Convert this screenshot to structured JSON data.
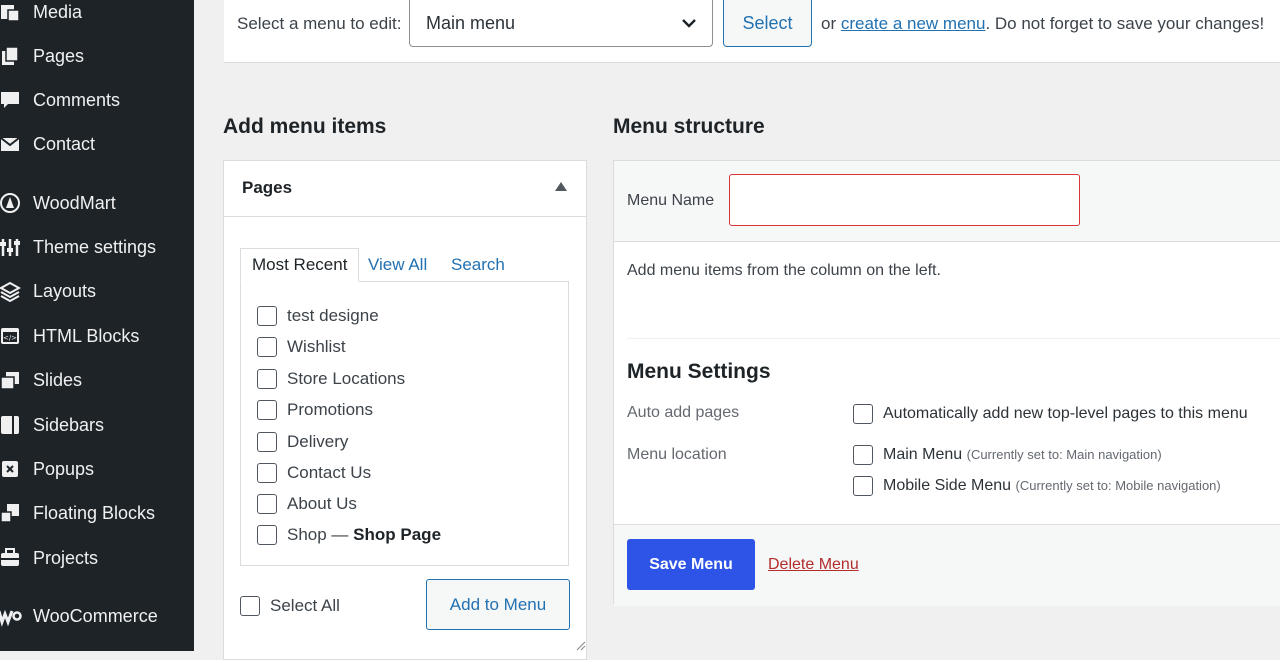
{
  "sidebar": {
    "items": [
      {
        "label": "Media",
        "icon": "media-icon"
      },
      {
        "label": "Pages",
        "icon": "pages-icon"
      },
      {
        "label": "Comments",
        "icon": "comments-icon"
      },
      {
        "label": "Contact",
        "icon": "mail-icon"
      },
      {
        "label": "WoodMart",
        "icon": "woodmart-icon"
      },
      {
        "label": "Theme settings",
        "icon": "sliders-icon"
      },
      {
        "label": "Layouts",
        "icon": "layers-icon"
      },
      {
        "label": "HTML Blocks",
        "icon": "html-icon"
      },
      {
        "label": "Slides",
        "icon": "slides-icon"
      },
      {
        "label": "Sidebars",
        "icon": "sidebar-icon"
      },
      {
        "label": "Popups",
        "icon": "popup-icon"
      },
      {
        "label": "Floating Blocks",
        "icon": "floating-icon"
      },
      {
        "label": "Projects",
        "icon": "briefcase-icon"
      },
      {
        "label": "WooCommerce",
        "icon": "woocommerce-icon"
      }
    ]
  },
  "topbar": {
    "label": "Select a menu to edit:",
    "selected_menu": "Main menu",
    "select_button": "Select",
    "hint_prefix": "or",
    "create_link": "create a new menu",
    "hint_suffix": ". Do not forget to save your changes!"
  },
  "add_items": {
    "heading": "Add menu items",
    "panel_title": "Pages",
    "tabs": [
      "Most Recent",
      "View All",
      "Search"
    ],
    "pages": [
      "test designe",
      "Wishlist",
      "Store Locations",
      "Promotions",
      "Delivery",
      "Contact Us",
      "About Us"
    ],
    "shop_label": "Shop —",
    "shop_suffix": "Shop Page",
    "select_all": "Select All",
    "add_button": "Add to Menu"
  },
  "structure": {
    "heading": "Menu structure",
    "name_label": "Menu Name",
    "name_value": "",
    "hint": "Add menu items from the column on the left.",
    "settings_title": "Menu Settings",
    "auto_add_label": "Auto add pages",
    "auto_add_option": "Automatically add new top-level pages to this menu",
    "location_label": "Menu location",
    "locations": [
      {
        "name": "Main Menu",
        "note": "(Currently set to: Main navigation)"
      },
      {
        "name": "Mobile Side Menu",
        "note": "(Currently set to: Mobile navigation)"
      }
    ],
    "save_button": "Save Menu",
    "delete_link": "Delete Menu"
  },
  "colors": {
    "sidebar_bg": "#1d2327",
    "link": "#2271b1",
    "primary_button": "#2d54e6",
    "delete": "#b32d2e",
    "error_border": "#d63638"
  }
}
